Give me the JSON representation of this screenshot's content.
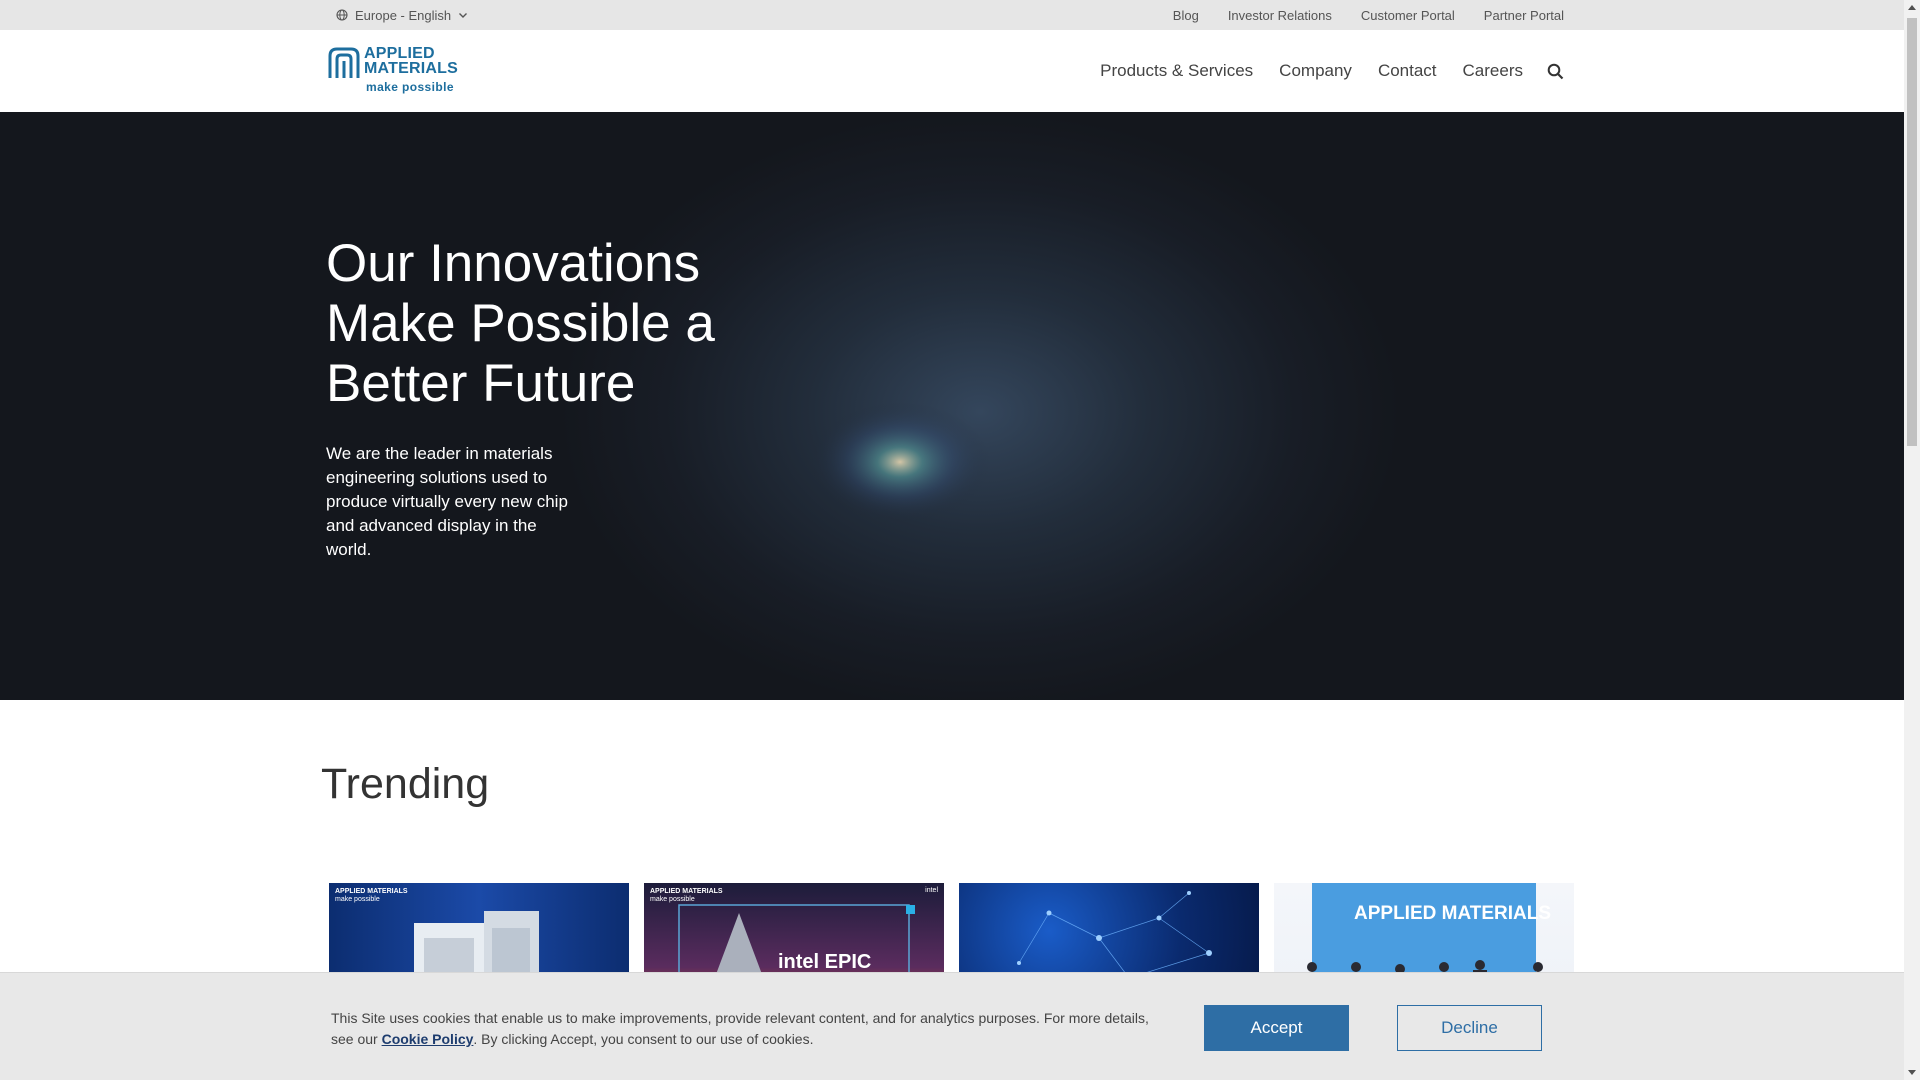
{
  "utility_bar": {
    "region": "Europe - English",
    "links": [
      "Blog",
      "Investor Relations",
      "Customer Portal",
      "Partner Portal"
    ]
  },
  "header": {
    "logo": {
      "line1": "APPLIED",
      "line2": "MATERIALS",
      "tagline": "make possible"
    },
    "nav": [
      "Products & Services",
      "Company",
      "Contact",
      "Careers"
    ],
    "search_icon": "search-icon"
  },
  "hero": {
    "title_lines": [
      "Our Innovations",
      "Make Possible a",
      "Better Future"
    ],
    "text": "We are the leader in materials engineering solutions used to produce virtually every new chip and advanced display in the world."
  },
  "trending": {
    "title": "Trending",
    "cards": [
      {
        "logo": "APPLIED MATERIALS",
        "tagline": "make possible"
      },
      {
        "logo": "APPLIED MATERIALS",
        "tagline": "make possible",
        "banner": "intel EPIC",
        "badge": "intel"
      },
      {},
      {
        "banner_logo": "APPLIED MATERIALS"
      }
    ]
  },
  "cookie": {
    "text_before": "This Site uses cookies that enable us to make improvements, provide relevant content, and for analytics purposes. For more details, see our ",
    "policy_link": "Cookie Policy",
    "text_after": ". By clicking Accept, you consent to our use of cookies.",
    "accept": "Accept",
    "decline": "Decline"
  },
  "colors": {
    "brand_blue": "#1d6e9e",
    "button_blue": "#2e6ea5",
    "hero_bg": "#181d26"
  }
}
